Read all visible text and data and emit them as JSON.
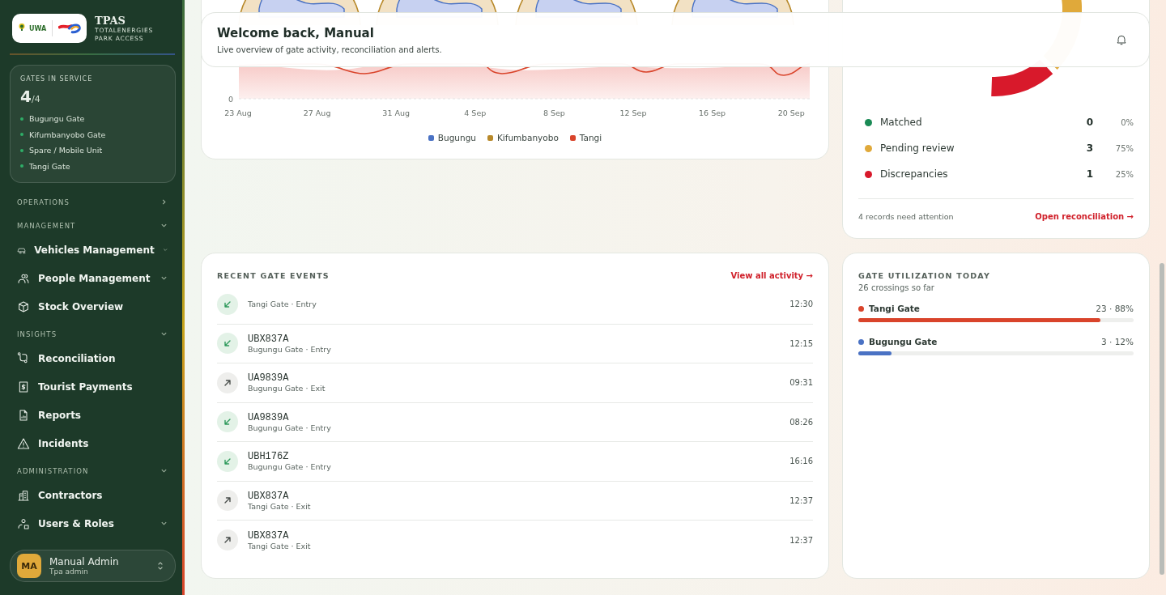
{
  "brand": {
    "title": "TPAS",
    "subtitle_lines": [
      "TOTALENERGIES",
      "PARK ACCESS"
    ],
    "emblem_text": "UWA"
  },
  "gates_card": {
    "title": "GATES IN SERVICE",
    "count": "4",
    "total": "/4",
    "gates": [
      {
        "name": "Bugungu Gate",
        "color": "#2fae67"
      },
      {
        "name": "Kifumbanyobo Gate",
        "color": "#2fae67"
      },
      {
        "name": "Spare / Mobile Unit",
        "color": "#2fae67"
      },
      {
        "name": "Tangi Gate",
        "color": "#2fae67"
      }
    ]
  },
  "nav": [
    {
      "kind": "section",
      "label": "OPERATIONS",
      "expanded": false
    },
    {
      "kind": "section",
      "label": "MANAGEMENT",
      "expanded": true
    },
    {
      "kind": "item",
      "label": "Vehicles Management",
      "submenu": true
    },
    {
      "kind": "item",
      "label": "People Management",
      "submenu": true
    },
    {
      "kind": "item",
      "label": "Stock Overview",
      "submenu": false
    },
    {
      "kind": "section",
      "label": "INSIGHTS",
      "expanded": true
    },
    {
      "kind": "item",
      "label": "Reconciliation",
      "submenu": false
    },
    {
      "kind": "item",
      "label": "Tourist Payments",
      "submenu": false
    },
    {
      "kind": "item",
      "label": "Reports",
      "submenu": false
    },
    {
      "kind": "item",
      "label": "Incidents",
      "submenu": false
    },
    {
      "kind": "section",
      "label": "ADMINISTRATION",
      "expanded": true
    },
    {
      "kind": "item",
      "label": "Contractors",
      "submenu": false
    },
    {
      "kind": "item",
      "label": "Users & Roles",
      "submenu": true
    }
  ],
  "user": {
    "initials": "MA",
    "name": "Manual Admin",
    "role": "Tpa admin"
  },
  "header": {
    "title": "Welcome back, Manual",
    "subtitle": "Live overview of gate activity, reconciliation and alerts."
  },
  "activity_chart": {
    "y_tick": "0",
    "x_labels": [
      "23 Aug",
      "27 Aug",
      "31 Aug",
      "4 Sep",
      "8 Sep",
      "12 Sep",
      "16 Sep",
      "20 Sep"
    ],
    "legend": [
      {
        "label": "Bugungu",
        "color": "#4a72c4"
      },
      {
        "label": "Kifumbanyobo",
        "color": "#b8892a"
      },
      {
        "label": "Tangi",
        "color": "#d9442b"
      }
    ]
  },
  "reconciliation": {
    "legend": [
      {
        "label": "Matched",
        "count": "0",
        "percent": "0%",
        "color": "#1a8a55"
      },
      {
        "label": "Pending review",
        "count": "3",
        "percent": "75%",
        "color": "#e0a93a"
      },
      {
        "label": "Discrepancies",
        "count": "1",
        "percent": "25%",
        "color": "#d8192b"
      }
    ],
    "footer_note": "4 records need attention",
    "link": "Open reconciliation →"
  },
  "events": {
    "title": "RECENT GATE EVENTS",
    "link": "View all activity →",
    "items": [
      {
        "detail": "Tangi Gate · Entry",
        "time": "12:30",
        "kind": "entry"
      },
      {
        "plate": "UBX837A",
        "detail": "Bugungu Gate · Entry",
        "time": "12:15",
        "kind": "entry"
      },
      {
        "plate": "UA9839A",
        "detail": "Bugungu Gate · Exit",
        "time": "09:31",
        "kind": "exit"
      },
      {
        "plate": "UA9839A",
        "detail": "Bugungu Gate · Entry",
        "time": "08:26",
        "kind": "entry"
      },
      {
        "plate": "UBH176Z",
        "detail": "Bugungu Gate · Entry",
        "time": "16:16",
        "kind": "entry"
      },
      {
        "plate": "UBX837A",
        "detail": "Tangi Gate · Exit",
        "time": "12:37",
        "kind": "exit"
      },
      {
        "plate": "UBX837A",
        "detail": "Tangi Gate · Exit",
        "time": "12:37",
        "kind": "exit"
      }
    ]
  },
  "utilization": {
    "title": "GATE UTILIZATION TODAY",
    "subtitle": "26 crossings so far",
    "gates": [
      {
        "name": "Tangi Gate",
        "reading": "23 · 88%",
        "level": 0.88,
        "color": "#d9442b"
      },
      {
        "name": "Bugungu Gate",
        "reading": "3 · 12%",
        "level": 0.12,
        "color": "#4a72c4"
      }
    ]
  }
}
